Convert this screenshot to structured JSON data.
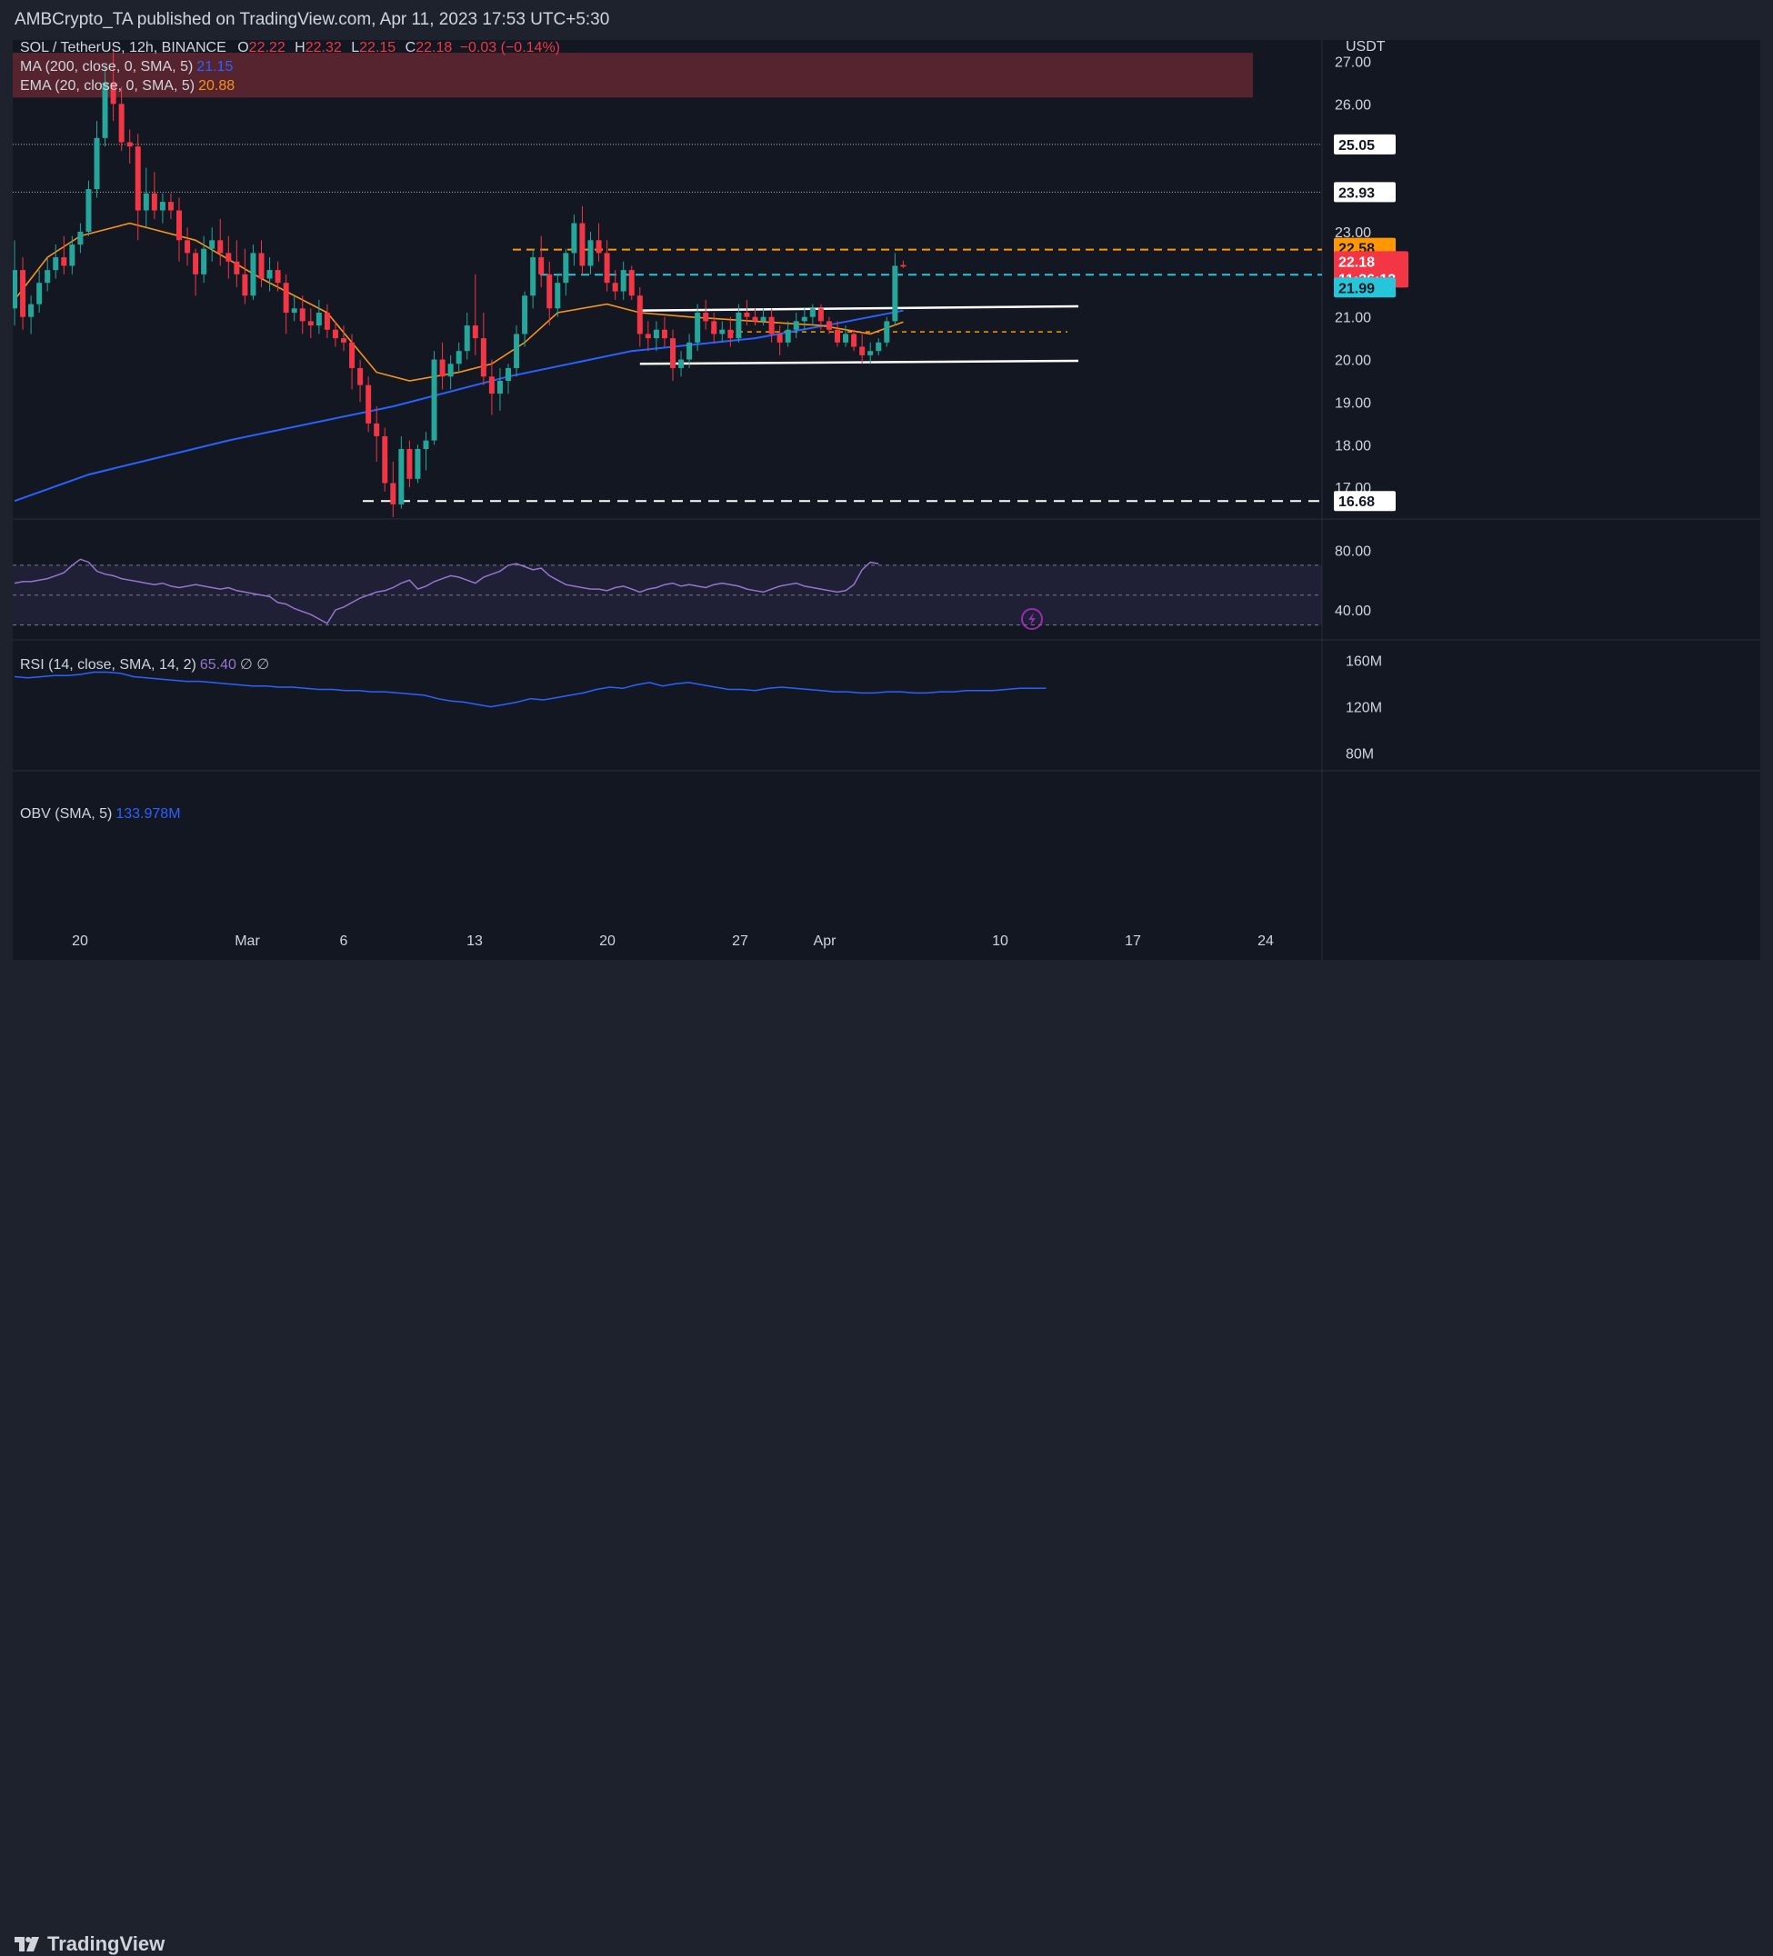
{
  "header": {
    "published": "AMBCrypto_TA published on TradingView.com, Apr 11, 2023 17:53 UTC+5:30"
  },
  "footer": {
    "brand": "TradingView"
  },
  "legend": {
    "symbol": "SOL / TetherUS, 12h, BINANCE",
    "ohlc": {
      "o_label": "O",
      "o": "22.22",
      "h_label": "H",
      "h": "22.32",
      "l_label": "L",
      "l": "22.15",
      "c_label": "C",
      "c": "22.18",
      "change": "−0.03 (−0.14%)"
    },
    "ma": {
      "label": "MA (200, close, 0, SMA, 5)",
      "value": "21.15"
    },
    "ema": {
      "label": "EMA (20, close, 0, SMA, 5)",
      "value": "20.88"
    },
    "rsi": {
      "label": "RSI (14, close, SMA, 14, 2)",
      "value": "65.40",
      "extra": "∅ ∅"
    },
    "obv": {
      "label": "OBV (SMA, 5)",
      "value": "133.978M"
    }
  },
  "colors": {
    "up": "#26a69a",
    "down": "#f23645",
    "bg": "#131722",
    "ma": "#2962ff",
    "ema": "#f7931a",
    "rsi": "#9575cd",
    "obv": "#2962ff",
    "currency": "#d1d4dc"
  },
  "axis": {
    "currency": "USDT",
    "price_ticks": [
      "27.00",
      "26.00",
      "23.00",
      "21.00",
      "20.00",
      "19.00",
      "18.00",
      "17.00"
    ],
    "rsi_ticks": [
      "80.00",
      "40.00"
    ],
    "obv_ticks": [
      "160M",
      "120M",
      "80M"
    ],
    "x_ticks": [
      "20",
      "Mar",
      "6",
      "13",
      "20",
      "27",
      "Apr",
      "10",
      "17",
      "24"
    ]
  },
  "price_tags": [
    {
      "value": "25.05",
      "style": "white"
    },
    {
      "value": "23.93",
      "style": "white"
    },
    {
      "value": "22.58",
      "style": "orange"
    },
    {
      "value": "22.18",
      "style": "red",
      "sub": "11:36:13"
    },
    {
      "value": "21.99",
      "style": "cyan"
    },
    {
      "value": "16.68",
      "style": "white"
    }
  ],
  "chart_data": {
    "type": "candlestick",
    "symbol": "SOL / TetherUS",
    "interval": "12h",
    "exchange": "BINANCE",
    "ylim": [
      16.3,
      27.5
    ],
    "candles": [
      {
        "o": 21.2,
        "h": 22.8,
        "l": 20.8,
        "c": 22.1
      },
      {
        "o": 22.1,
        "h": 22.4,
        "l": 20.7,
        "c": 21.0
      },
      {
        "o": 21.0,
        "h": 21.5,
        "l": 20.6,
        "c": 21.3
      },
      {
        "o": 21.3,
        "h": 22.1,
        "l": 21.1,
        "c": 21.8
      },
      {
        "o": 21.8,
        "h": 22.4,
        "l": 21.6,
        "c": 22.1
      },
      {
        "o": 22.1,
        "h": 22.7,
        "l": 21.9,
        "c": 22.4
      },
      {
        "o": 22.4,
        "h": 22.9,
        "l": 22.0,
        "c": 22.2
      },
      {
        "o": 22.2,
        "h": 22.9,
        "l": 22.0,
        "c": 22.7
      },
      {
        "o": 22.7,
        "h": 23.2,
        "l": 22.5,
        "c": 23.0
      },
      {
        "o": 23.0,
        "h": 24.2,
        "l": 22.9,
        "c": 24.0
      },
      {
        "o": 24.0,
        "h": 25.6,
        "l": 23.8,
        "c": 25.2
      },
      {
        "o": 25.2,
        "h": 26.9,
        "l": 25.0,
        "c": 26.5
      },
      {
        "o": 26.5,
        "h": 27.3,
        "l": 25.6,
        "c": 26.0
      },
      {
        "o": 26.0,
        "h": 26.4,
        "l": 24.9,
        "c": 25.1
      },
      {
        "o": 25.1,
        "h": 25.4,
        "l": 24.6,
        "c": 25.0
      },
      {
        "o": 25.0,
        "h": 25.3,
        "l": 22.8,
        "c": 23.5
      },
      {
        "o": 23.5,
        "h": 24.5,
        "l": 23.1,
        "c": 23.9
      },
      {
        "o": 23.9,
        "h": 24.4,
        "l": 23.3,
        "c": 23.5
      },
      {
        "o": 23.5,
        "h": 23.9,
        "l": 23.2,
        "c": 23.7
      },
      {
        "o": 23.7,
        "h": 23.9,
        "l": 23.3,
        "c": 23.5
      },
      {
        "o": 23.5,
        "h": 23.8,
        "l": 22.3,
        "c": 22.8
      },
      {
        "o": 22.8,
        "h": 23.1,
        "l": 22.2,
        "c": 22.5
      },
      {
        "o": 22.5,
        "h": 22.6,
        "l": 21.5,
        "c": 22.0
      },
      {
        "o": 22.0,
        "h": 22.9,
        "l": 21.8,
        "c": 22.6
      },
      {
        "o": 22.6,
        "h": 23.1,
        "l": 22.3,
        "c": 22.8
      },
      {
        "o": 22.8,
        "h": 23.3,
        "l": 22.2,
        "c": 22.5
      },
      {
        "o": 22.5,
        "h": 22.9,
        "l": 21.9,
        "c": 22.3
      },
      {
        "o": 22.3,
        "h": 22.8,
        "l": 21.7,
        "c": 22.0
      },
      {
        "o": 22.0,
        "h": 22.6,
        "l": 21.3,
        "c": 21.5
      },
      {
        "o": 21.5,
        "h": 22.7,
        "l": 21.4,
        "c": 22.5
      },
      {
        "o": 22.5,
        "h": 22.8,
        "l": 21.7,
        "c": 21.9
      },
      {
        "o": 21.9,
        "h": 22.4,
        "l": 21.6,
        "c": 22.1
      },
      {
        "o": 22.1,
        "h": 22.3,
        "l": 21.6,
        "c": 21.8
      },
      {
        "o": 21.8,
        "h": 22.0,
        "l": 20.6,
        "c": 21.1
      },
      {
        "o": 21.1,
        "h": 21.5,
        "l": 20.9,
        "c": 21.2
      },
      {
        "o": 21.2,
        "h": 21.5,
        "l": 20.6,
        "c": 20.9
      },
      {
        "o": 20.9,
        "h": 21.2,
        "l": 20.5,
        "c": 20.8
      },
      {
        "o": 20.8,
        "h": 21.4,
        "l": 20.6,
        "c": 21.1
      },
      {
        "o": 21.1,
        "h": 21.3,
        "l": 20.5,
        "c": 20.7
      },
      {
        "o": 20.7,
        "h": 20.9,
        "l": 20.3,
        "c": 20.5
      },
      {
        "o": 20.5,
        "h": 20.8,
        "l": 20.2,
        "c": 20.4
      },
      {
        "o": 20.4,
        "h": 20.6,
        "l": 19.3,
        "c": 19.8
      },
      {
        "o": 19.8,
        "h": 20.0,
        "l": 19.0,
        "c": 19.4
      },
      {
        "o": 19.4,
        "h": 19.6,
        "l": 18.3,
        "c": 18.5
      },
      {
        "o": 18.5,
        "h": 18.9,
        "l": 17.6,
        "c": 18.2
      },
      {
        "o": 18.2,
        "h": 18.4,
        "l": 16.9,
        "c": 17.1
      },
      {
        "o": 17.1,
        "h": 17.6,
        "l": 16.3,
        "c": 16.6
      },
      {
        "o": 16.6,
        "h": 18.2,
        "l": 16.5,
        "c": 17.9
      },
      {
        "o": 17.9,
        "h": 18.1,
        "l": 17.0,
        "c": 17.2
      },
      {
        "o": 17.2,
        "h": 18.0,
        "l": 17.1,
        "c": 17.9
      },
      {
        "o": 17.9,
        "h": 18.3,
        "l": 17.4,
        "c": 18.1
      },
      {
        "o": 18.1,
        "h": 20.2,
        "l": 18.0,
        "c": 20.0
      },
      {
        "o": 20.0,
        "h": 20.4,
        "l": 19.3,
        "c": 19.6
      },
      {
        "o": 19.6,
        "h": 20.1,
        "l": 19.3,
        "c": 19.9
      },
      {
        "o": 19.9,
        "h": 20.4,
        "l": 19.7,
        "c": 20.2
      },
      {
        "o": 20.2,
        "h": 21.1,
        "l": 20.0,
        "c": 20.8
      },
      {
        "o": 20.8,
        "h": 22.0,
        "l": 20.1,
        "c": 20.5
      },
      {
        "o": 20.5,
        "h": 21.1,
        "l": 19.4,
        "c": 19.6
      },
      {
        "o": 19.6,
        "h": 20.0,
        "l": 18.7,
        "c": 19.2
      },
      {
        "o": 19.2,
        "h": 19.8,
        "l": 18.8,
        "c": 19.5
      },
      {
        "o": 19.5,
        "h": 19.9,
        "l": 19.2,
        "c": 19.8
      },
      {
        "o": 19.8,
        "h": 20.8,
        "l": 19.6,
        "c": 20.6
      },
      {
        "o": 20.6,
        "h": 21.6,
        "l": 20.3,
        "c": 21.5
      },
      {
        "o": 21.5,
        "h": 22.6,
        "l": 21.2,
        "c": 22.4
      },
      {
        "o": 22.4,
        "h": 22.9,
        "l": 21.7,
        "c": 22.0
      },
      {
        "o": 22.0,
        "h": 22.3,
        "l": 20.8,
        "c": 21.2
      },
      {
        "o": 21.2,
        "h": 22.0,
        "l": 21.0,
        "c": 21.8
      },
      {
        "o": 21.8,
        "h": 22.6,
        "l": 21.5,
        "c": 22.5
      },
      {
        "o": 22.5,
        "h": 23.4,
        "l": 22.2,
        "c": 23.2
      },
      {
        "o": 23.2,
        "h": 23.6,
        "l": 22.0,
        "c": 22.2
      },
      {
        "o": 22.2,
        "h": 23.0,
        "l": 22.0,
        "c": 22.8
      },
      {
        "o": 22.8,
        "h": 23.2,
        "l": 22.3,
        "c": 22.5
      },
      {
        "o": 22.5,
        "h": 22.8,
        "l": 21.6,
        "c": 21.8
      },
      {
        "o": 21.8,
        "h": 22.1,
        "l": 21.4,
        "c": 21.6
      },
      {
        "o": 21.6,
        "h": 22.3,
        "l": 21.4,
        "c": 22.1
      },
      {
        "o": 22.1,
        "h": 22.2,
        "l": 21.4,
        "c": 21.5
      },
      {
        "o": 21.5,
        "h": 21.7,
        "l": 20.3,
        "c": 20.6
      },
      {
        "o": 20.6,
        "h": 20.9,
        "l": 20.2,
        "c": 20.5
      },
      {
        "o": 20.5,
        "h": 20.9,
        "l": 20.2,
        "c": 20.7
      },
      {
        "o": 20.7,
        "h": 21.0,
        "l": 20.3,
        "c": 20.5
      },
      {
        "o": 20.5,
        "h": 20.7,
        "l": 19.5,
        "c": 19.8
      },
      {
        "o": 19.8,
        "h": 20.2,
        "l": 19.6,
        "c": 20.0
      },
      {
        "o": 20.0,
        "h": 20.6,
        "l": 19.8,
        "c": 20.4
      },
      {
        "o": 20.4,
        "h": 21.3,
        "l": 20.2,
        "c": 21.1
      },
      {
        "o": 21.1,
        "h": 21.4,
        "l": 20.7,
        "c": 20.9
      },
      {
        "o": 20.9,
        "h": 21.1,
        "l": 20.4,
        "c": 20.6
      },
      {
        "o": 20.6,
        "h": 20.9,
        "l": 20.4,
        "c": 20.7
      },
      {
        "o": 20.7,
        "h": 21.0,
        "l": 20.3,
        "c": 20.5
      },
      {
        "o": 20.5,
        "h": 21.3,
        "l": 20.4,
        "c": 21.1
      },
      {
        "o": 21.1,
        "h": 21.4,
        "l": 20.8,
        "c": 21.0
      },
      {
        "o": 21.0,
        "h": 21.2,
        "l": 20.8,
        "c": 20.9
      },
      {
        "o": 20.9,
        "h": 21.2,
        "l": 20.8,
        "c": 21.0
      },
      {
        "o": 21.0,
        "h": 21.2,
        "l": 20.4,
        "c": 20.6
      },
      {
        "o": 20.6,
        "h": 20.8,
        "l": 20.1,
        "c": 20.4
      },
      {
        "o": 20.4,
        "h": 20.9,
        "l": 20.3,
        "c": 20.7
      },
      {
        "o": 20.7,
        "h": 21.1,
        "l": 20.5,
        "c": 20.9
      },
      {
        "o": 20.9,
        "h": 21.2,
        "l": 20.7,
        "c": 21.0
      },
      {
        "o": 21.0,
        "h": 21.3,
        "l": 20.8,
        "c": 21.2
      },
      {
        "o": 21.2,
        "h": 21.3,
        "l": 20.7,
        "c": 20.9
      },
      {
        "o": 20.9,
        "h": 21.0,
        "l": 20.6,
        "c": 20.7
      },
      {
        "o": 20.7,
        "h": 20.9,
        "l": 20.3,
        "c": 20.4
      },
      {
        "o": 20.4,
        "h": 20.8,
        "l": 20.3,
        "c": 20.6
      },
      {
        "o": 20.6,
        "h": 20.7,
        "l": 20.2,
        "c": 20.3
      },
      {
        "o": 20.3,
        "h": 20.6,
        "l": 19.9,
        "c": 20.1
      },
      {
        "o": 20.1,
        "h": 20.4,
        "l": 19.9,
        "c": 20.2
      },
      {
        "o": 20.2,
        "h": 20.5,
        "l": 20.1,
        "c": 20.4
      },
      {
        "o": 20.4,
        "h": 21.0,
        "l": 20.3,
        "c": 20.9
      },
      {
        "o": 20.9,
        "h": 22.5,
        "l": 20.8,
        "c": 22.2
      },
      {
        "o": 22.22,
        "h": 22.32,
        "l": 22.15,
        "c": 22.18
      }
    ],
    "ma200": [
      [
        0,
        16.68
      ],
      [
        9,
        17.3
      ],
      [
        26,
        18.1
      ],
      [
        46,
        18.9
      ],
      [
        60,
        19.6
      ],
      [
        75,
        20.2
      ],
      [
        90,
        20.5
      ],
      [
        100,
        20.85
      ],
      [
        108,
        21.15
      ]
    ],
    "ema20": [
      [
        0,
        21.4
      ],
      [
        4,
        22.4
      ],
      [
        8,
        22.9
      ],
      [
        14,
        23.2
      ],
      [
        22,
        22.8
      ],
      [
        30,
        21.9
      ],
      [
        38,
        21.1
      ],
      [
        44,
        19.7
      ],
      [
        48,
        19.5
      ],
      [
        54,
        19.7
      ],
      [
        58,
        19.9
      ],
      [
        62,
        20.4
      ],
      [
        66,
        21.1
      ],
      [
        72,
        21.3
      ],
      [
        76,
        21.1
      ],
      [
        82,
        21.0
      ],
      [
        90,
        20.9
      ],
      [
        98,
        20.8
      ],
      [
        104,
        20.6
      ],
      [
        108,
        20.88
      ]
    ],
    "levels": [
      {
        "value": 25.05,
        "style": "dotted"
      },
      {
        "value": 23.93,
        "style": "dotted"
      },
      {
        "value": 22.58,
        "style": "orange-dashed"
      },
      {
        "value": 21.99,
        "style": "cyan-dashed"
      },
      {
        "value": 20.65,
        "style": "orange-dashed-short"
      },
      {
        "value": 16.68,
        "style": "white-dashed"
      }
    ],
    "supply_zone": [
      26.15,
      27.2
    ],
    "channel": {
      "upper": [
        21.15,
        21.25
      ],
      "lower": [
        19.9,
        19.97
      ],
      "start_index": 76,
      "end_index": 117
    },
    "rsi": {
      "ylim": [
        20,
        90
      ],
      "values": [
        58,
        59,
        59,
        60,
        61,
        63,
        65,
        70,
        74,
        72,
        66,
        64,
        63,
        61,
        60,
        59,
        58,
        57,
        58,
        56,
        55,
        56,
        57,
        56,
        55,
        54,
        55,
        53,
        52,
        51,
        50,
        49,
        45,
        44,
        41,
        39,
        37,
        34,
        31,
        40,
        42,
        45,
        48,
        50,
        52,
        53,
        55,
        58,
        60,
        54,
        56,
        59,
        61,
        63,
        62,
        60,
        58,
        62,
        64,
        66,
        70,
        71,
        69,
        67,
        68,
        63,
        60,
        57,
        56,
        55,
        54,
        54,
        53,
        55,
        56,
        54,
        52,
        54,
        55,
        57,
        58,
        56,
        57,
        56,
        55,
        57,
        58,
        57,
        56,
        54,
        53,
        52,
        54,
        56,
        57,
        58,
        56,
        55,
        54,
        53,
        52,
        53,
        57,
        67,
        72,
        71
      ],
      "bands": [
        70,
        50,
        30
      ]
    },
    "obv": {
      "ylim": [
        60,
        170
      ],
      "values": [
        146,
        145,
        146,
        147,
        147,
        148,
        150,
        150,
        149,
        146,
        145,
        144,
        143,
        142,
        142,
        141,
        140,
        139,
        138,
        138,
        137,
        137,
        136,
        135,
        135,
        134,
        134,
        133,
        133,
        132,
        131,
        130,
        127,
        125,
        124,
        122,
        120,
        122,
        124,
        127,
        126,
        128,
        130,
        132,
        135,
        137,
        136,
        139,
        141,
        138,
        140,
        141,
        139,
        137,
        135,
        135,
        134,
        136,
        137,
        136,
        135,
        134,
        133,
        133,
        132,
        132,
        133,
        133,
        132,
        132,
        133,
        133,
        134,
        134,
        134,
        135,
        136,
        136,
        136
      ],
      "ticks": [
        160,
        120,
        80
      ]
    },
    "x_ticks": [
      "20",
      "Mar",
      "6",
      "13",
      "20",
      "27",
      "Apr",
      "10",
      "17",
      "24"
    ]
  }
}
